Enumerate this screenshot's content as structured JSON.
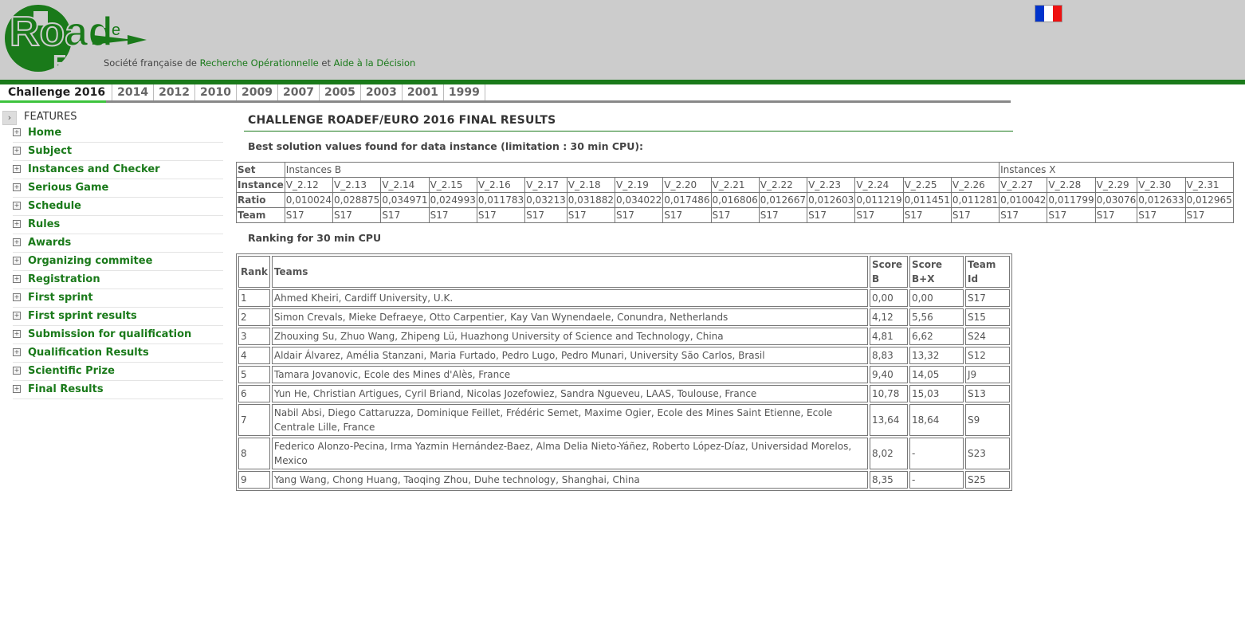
{
  "header": {
    "tagline_pre": "Société française de ",
    "tagline_ro": "Recherche Opérationnelle",
    "tagline_mid": " et ",
    "tagline_ad": "Aide à la Décision",
    "logo_icon": "roadef-logo",
    "flag_icon": "french-flag-icon",
    "flag_colors": [
      "#0033cc",
      "#ffffff",
      "#ee1111"
    ]
  },
  "colors": {
    "brand_green": "#1a7a1a",
    "header_bg": "#cccccc",
    "tab_active_underline": "#3ec43e"
  },
  "tabs": [
    "Challenge 2016",
    "2014",
    "2012",
    "2010",
    "2009",
    "2007",
    "2005",
    "2003",
    "2001",
    "1999"
  ],
  "sidebar": {
    "section_label": "FEATURES",
    "items": [
      "Home",
      "Subject",
      "Instances and Checker",
      "Serious Game",
      "Schedule",
      "Rules",
      "Awards",
      "Organizing commitee",
      "Registration",
      "First sprint",
      "First sprint results",
      "Submission for qualification",
      "Qualification Results",
      "Scientific Prize",
      "Final Results"
    ]
  },
  "main": {
    "title": "CHALLENGE ROADEF/EURO 2016 FINAL RESULTS",
    "subtitle_best": "Best solution values found for data instance (limitation : 30 min CPU):",
    "subtitle_ranking": "Ranking for 30 min CPU"
  },
  "instances_table": {
    "row_labels": {
      "set": "Set",
      "instance": "Instance",
      "ratio": "Ratio",
      "team": "Team"
    },
    "set_b": "Instances B",
    "set_x": "Instances X",
    "instances": [
      "V_2.12",
      "V_2.13",
      "V_2.14",
      "V_2.15",
      "V_2.16",
      "V_2.17",
      "V_2.18",
      "V_2.19",
      "V_2.20",
      "V_2.21",
      "V_2.22",
      "V_2.23",
      "V_2.24",
      "V_2.25",
      "V_2.26",
      "V_2.27",
      "V_2.28",
      "V_2.29",
      "V_2.30",
      "V_2.31"
    ],
    "ratios": [
      "0,010024",
      "0,028875",
      "0,034971",
      "0,024993",
      "0,011783",
      "0,03213",
      "0,031882",
      "0,034022",
      "0,017486",
      "0,016806",
      "0,012667",
      "0,012603",
      "0,011219",
      "0,011451",
      "0,011281",
      "0,010042",
      "0,011799",
      "0,03076",
      "0,012633",
      "0,012965"
    ],
    "teams": [
      "S17",
      "S17",
      "S17",
      "S17",
      "S17",
      "S17",
      "S17",
      "S17",
      "S17",
      "S17",
      "S17",
      "S17",
      "S17",
      "S17",
      "S17",
      "S17",
      "S17",
      "S17",
      "S17",
      "S17"
    ]
  },
  "ranking_table": {
    "headers": [
      "Rank",
      "Teams",
      "Score B",
      "Score B+X",
      "Team Id"
    ],
    "rows": [
      [
        "1",
        "Ahmed Kheiri, Cardiff University, U.K.",
        "0,00",
        "0,00",
        "S17"
      ],
      [
        "2",
        "Simon Crevals, Mieke Defraeye, Otto Carpentier, Kay Van Wynendaele, Conundra, Netherlands",
        "4,12",
        "5,56",
        "S15"
      ],
      [
        "3",
        "Zhouxing Su, Zhuo Wang, Zhipeng Lü, Huazhong University of Science and Technology, China",
        "4,81",
        "6,62",
        "S24"
      ],
      [
        "4",
        "Aldair Álvarez, Amélia Stanzani, Maria Furtado, Pedro Lugo, Pedro Munari, University São Carlos, Brasil",
        "8,83",
        "13,32",
        "S12"
      ],
      [
        "5",
        "Tamara Jovanovic, Ecole des Mines d'Alès, France",
        "9,40",
        "14,05",
        "J9"
      ],
      [
        "6",
        "Yun He, Christian Artigues, Cyril Briand, Nicolas Jozefowiez, Sandra Ngueveu, LAAS, Toulouse, France",
        "10,78",
        "15,03",
        "S13"
      ],
      [
        "7",
        "Nabil Absi, Diego Cattaruzza, Dominique Feillet, Frédéric Semet, Maxime Ogier, Ecole des Mines Saint Etienne, Ecole Centrale Lille, France",
        "13,64",
        "18,64",
        "S9"
      ],
      [
        "8",
        "Federico Alonzo-Pecina, Irma Yazmin Hernández-Baez, Alma Delia Nieto-Yáñez, Roberto López-Díaz, Universidad Morelos, Mexico",
        "8,02",
        "-",
        "S23"
      ],
      [
        "9",
        "Yang Wang, Chong Huang, Taoqing Zhou, Duhe technology, Shanghai, China",
        "8,35",
        "-",
        "S25"
      ]
    ]
  }
}
